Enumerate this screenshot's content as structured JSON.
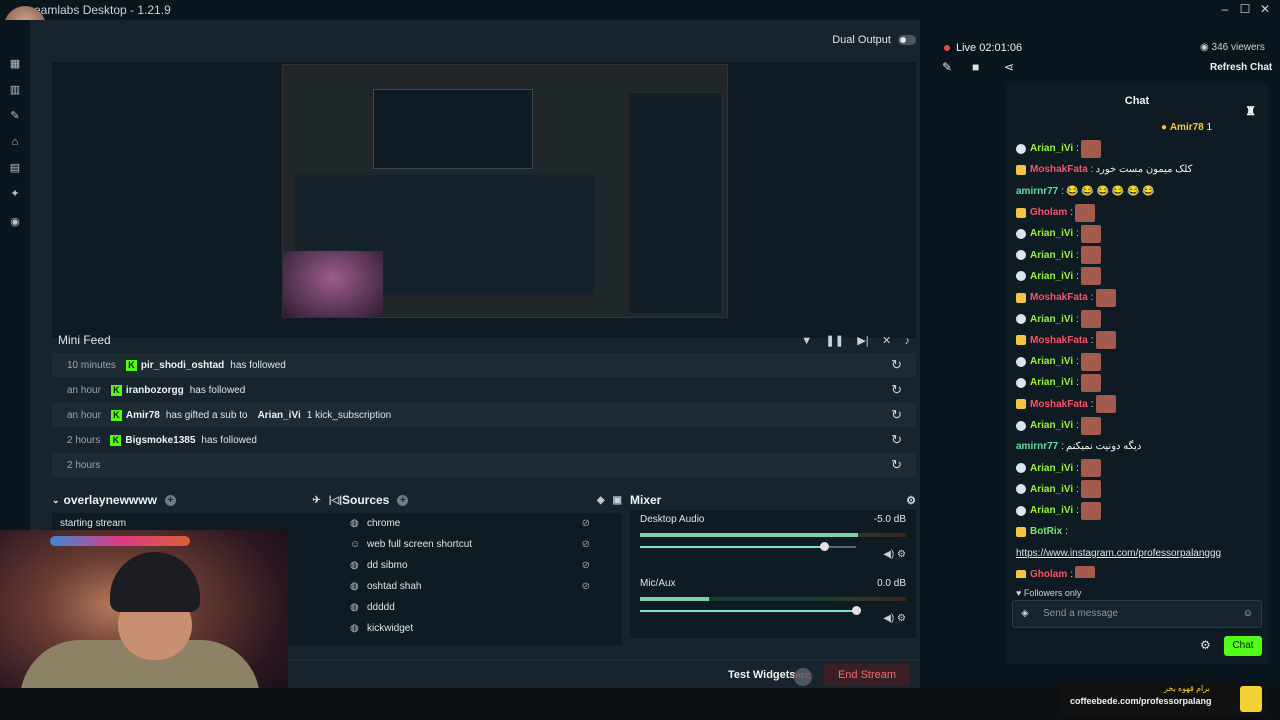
{
  "window": {
    "title": "eamlabs Desktop - 1.21.9"
  },
  "preview": {
    "dual_output_label": "Dual Output"
  },
  "mini_feed": {
    "title": "Mini Feed",
    "rows": [
      {
        "time": "10 minutes",
        "user": "pir_shodi_oshtad",
        "action": "has followed",
        "extra": ""
      },
      {
        "time": "an hour",
        "user": "iranbozorgg",
        "action": "has followed",
        "extra": ""
      },
      {
        "time": "an hour",
        "user": "Amir78",
        "action": "has gifted a sub to",
        "extra_user": "Arian_iVi",
        "extra": "1 kick_subscription"
      },
      {
        "time": "2 hours",
        "user": "Bigsmoke1385",
        "action": "has followed",
        "extra": ""
      },
      {
        "time": "2 hours",
        "user": "",
        "action": "",
        "extra": ""
      }
    ]
  },
  "scenes": {
    "collection_name": "overlaynewwww",
    "items": [
      "starting stream"
    ]
  },
  "sources": {
    "title": "Sources",
    "items": [
      "chrome",
      "web full screen shortcut",
      "dd sibmo",
      "oshtad shah",
      "ddddd",
      "kickwidget"
    ]
  },
  "mixer": {
    "title": "Mixer",
    "channels": [
      {
        "name": "Desktop Audio",
        "db": "-5.0 dB",
        "level": 0.82,
        "slider": 0.85
      },
      {
        "name": "Mic/Aux",
        "db": "0.0 dB",
        "level": 0.26,
        "slider": 1.0
      }
    ]
  },
  "footer": {
    "test_widgets": "Test Widgets",
    "rec_label": "REC",
    "end_stream": "End Stream"
  },
  "stream": {
    "live": "Live",
    "timer": "02:01:06",
    "viewers": "346 viewers",
    "refresh_chat": "Refresh Chat"
  },
  "chat": {
    "title": "Chat",
    "pinned_user": "Amir78",
    "pinned_count": "1",
    "followers_only": "Followers only",
    "placeholder": "Send a message",
    "send": "Chat",
    "messages": [
      {
        "name": "Arian_iVi",
        "color": "#9cf23a",
        "badge": "round",
        "text": "",
        "emote": true
      },
      {
        "name": "MoshakFata",
        "color": "#ff4f6b",
        "badge": "sq",
        "text": "کلک میمون مست خورد",
        "emote": false
      },
      {
        "name": "amirnr77",
        "color": "#5ee0a2",
        "badge": "none",
        "text": "😂 😂 😂 😂 😂 😂",
        "emote": false
      },
      {
        "name": "Gholam",
        "color": "#ff4f6b",
        "badge": "sq",
        "text": "",
        "emote": true
      },
      {
        "name": "Arian_iVi",
        "color": "#9cf23a",
        "badge": "round",
        "text": "",
        "emote": true
      },
      {
        "name": "Arian_iVi",
        "color": "#9cf23a",
        "badge": "round",
        "text": "",
        "emote": true
      },
      {
        "name": "Arian_iVi",
        "color": "#9cf23a",
        "badge": "round",
        "text": "",
        "emote": true
      },
      {
        "name": "MoshakFata",
        "color": "#ff4f6b",
        "badge": "sq",
        "text": "",
        "emote": true
      },
      {
        "name": "Arian_iVi",
        "color": "#9cf23a",
        "badge": "round",
        "text": "",
        "emote": true
      },
      {
        "name": "MoshakFata",
        "color": "#ff4f6b",
        "badge": "sq",
        "text": "",
        "emote": true
      },
      {
        "name": "Arian_iVi",
        "color": "#9cf23a",
        "badge": "round",
        "text": "",
        "emote": true
      },
      {
        "name": "Arian_iVi",
        "color": "#9cf23a",
        "badge": "round",
        "text": "",
        "emote": true
      },
      {
        "name": "MoshakFata",
        "color": "#ff4f6b",
        "badge": "sq",
        "text": "",
        "emote": true
      },
      {
        "name": "Arian_iVi",
        "color": "#9cf23a",
        "badge": "round",
        "text": "",
        "emote": true
      },
      {
        "name": "amirnr77",
        "color": "#5ee0a2",
        "badge": "none",
        "text": "دیگه دونیت نمیکنم",
        "emote": false
      },
      {
        "name": "Arian_iVi",
        "color": "#9cf23a",
        "badge": "round",
        "text": "",
        "emote": true
      },
      {
        "name": "Arian_iVi",
        "color": "#9cf23a",
        "badge": "round",
        "text": "",
        "emote": true
      },
      {
        "name": "Arian_iVi",
        "color": "#9cf23a",
        "badge": "round",
        "text": "",
        "emote": true
      },
      {
        "name": "BotRix",
        "color": "#7de36a",
        "badge": "sq",
        "text": "",
        "emote": false
      },
      {
        "name": "",
        "color": "#dfe4e8",
        "badge": "none",
        "text": "https://www.instagram.com/professorpalanggg",
        "emote": false,
        "link": true
      },
      {
        "name": "Gholam",
        "color": "#ff4f6b",
        "badge": "sq",
        "text": "",
        "emote": true
      }
    ]
  },
  "coffee": {
    "label": "coffeebede.com/professorpalang",
    "label_rtl": "برام قهوه بخر"
  },
  "colors": {
    "accent": "#53fc18",
    "live": "#e84c4c",
    "background": "#17242d"
  }
}
